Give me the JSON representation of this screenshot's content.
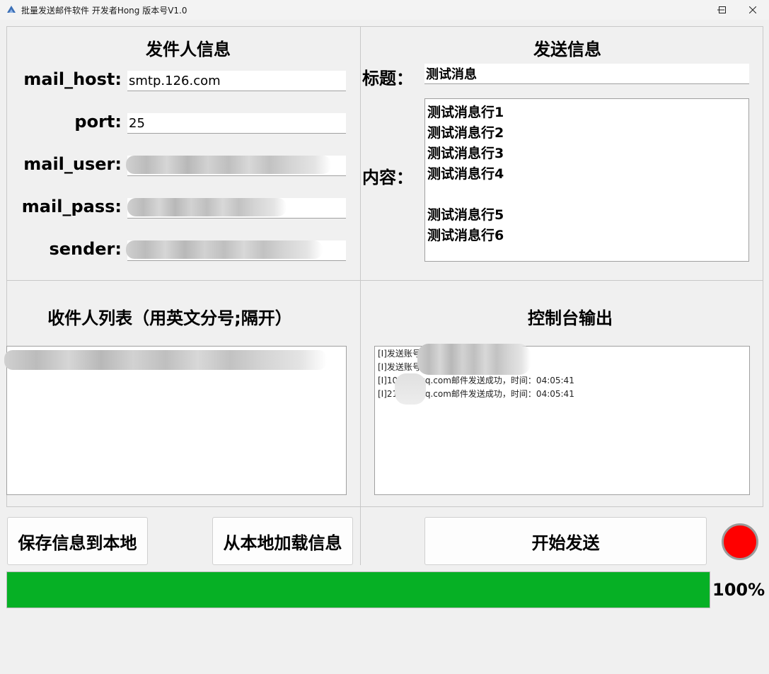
{
  "window": {
    "title": "批量发送邮件软件 开发者Hong 版本号V1.0",
    "icon": "app-logo-icon"
  },
  "sender_panel": {
    "title": "发件人信息",
    "fields": [
      {
        "label": "mail_host:",
        "value": "smtp.126.com",
        "redacted": false
      },
      {
        "label": "port:",
        "value": "25",
        "redacted": false
      },
      {
        "label": "mail_user:",
        "value": "",
        "redacted": true
      },
      {
        "label": "mail_pass:",
        "value": "",
        "redacted": true
      },
      {
        "label": "sender:",
        "value": "",
        "redacted": true
      }
    ]
  },
  "send_panel": {
    "title": "发送信息",
    "subject_label": "标题：",
    "subject_value": "测试消息",
    "content_label": "内容：",
    "content_lines": [
      "测试消息行1",
      "测试消息行2",
      "测试消息行3",
      "测试消息行4",
      "",
      "测试消息行5",
      "测试消息行6"
    ]
  },
  "recipients_panel": {
    "title": "收件人列表（用英文分号;隔开）",
    "redacted": true
  },
  "console_panel": {
    "title": "控制台输出",
    "lines": [
      "[I]发送账号                                    配置加载完成",
      "[I]发送账号                                    配置加载完成",
      "[I]10          25@qq.com邮件发送成功，时间：04:05:41",
      "[I]21          11@qq.com邮件发送成功，时间：04:05:41"
    ]
  },
  "buttons": {
    "save": "保存信息到本地",
    "load": "从本地加载信息",
    "start": "开始发送"
  },
  "status": {
    "indicator_color": "#ff0000"
  },
  "progress": {
    "percent": 100,
    "label": "100%",
    "color": "#06b025"
  }
}
